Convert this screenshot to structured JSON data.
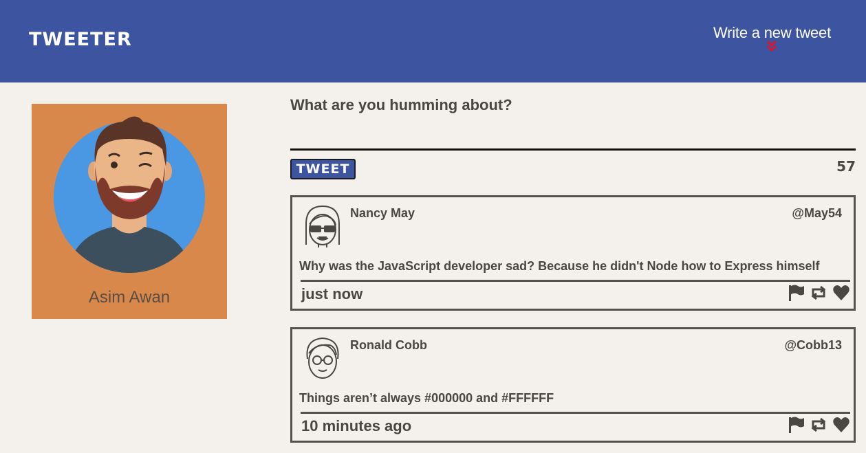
{
  "nav": {
    "brand": "TWEETER",
    "compose_label": "Write a new tweet",
    "compose_icon": "double-chevron-down-icon",
    "compose_icon_color": "#e0132c"
  },
  "profile": {
    "name": "Asim Awan",
    "background_color": "#d8884a"
  },
  "composer": {
    "placeholder": "What are you humming about?",
    "button_label": "TWEET",
    "counter": "57"
  },
  "tweets": [
    {
      "name": "Nancy May",
      "handle": "@May54",
      "text": "Why was the JavaScript developer sad? Because he didn't Node how to Express himself",
      "time": "just now",
      "avatar": "woman-glasses-avatar-icon",
      "actions": [
        "flag-icon",
        "retweet-icon",
        "heart-icon"
      ]
    },
    {
      "name": "Ronald Cobb",
      "handle": "@Cobb13",
      "text": "Things aren’t always #000000 and #FFFFFF",
      "time": "10 minutes ago",
      "avatar": "man-glasses-avatar-icon",
      "actions": [
        "flag-icon",
        "retweet-icon",
        "heart-icon"
      ]
    }
  ],
  "colors": {
    "nav_bg": "#3d55a0",
    "page_bg": "#f4f1ec",
    "text": "#4a4743"
  }
}
